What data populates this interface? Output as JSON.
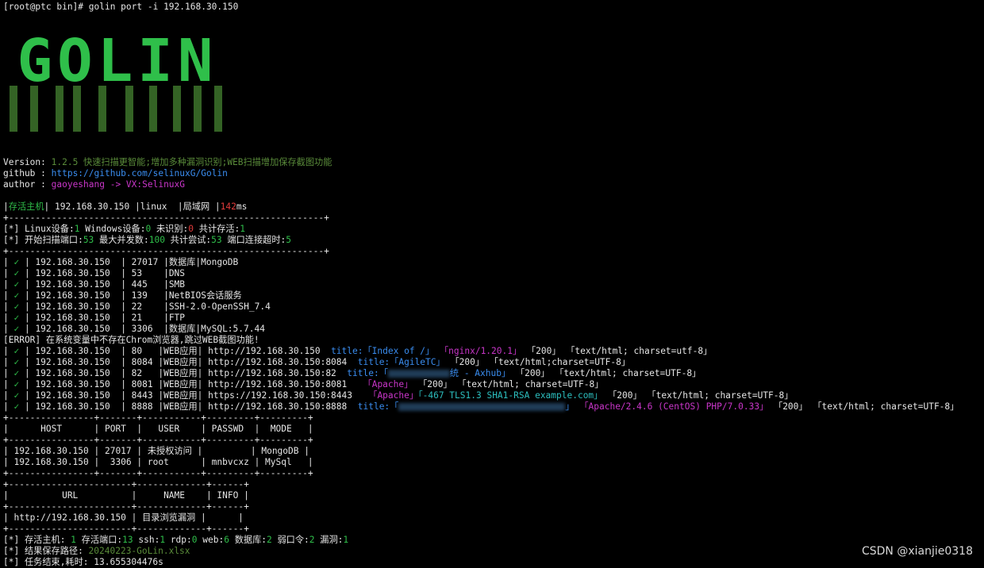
{
  "prompt": "[root@ptc bin]# golin port -i 192.168.30.150",
  "logo_text": "GOLIN",
  "info": {
    "version_label": "Version: ",
    "version_value": "1.2.5 快速扫描更智能;增加多种漏洞识别;WEB扫描增加保存截图功能",
    "github_label": "github : ",
    "github_value": "https://github.com/selinuxG/Golin",
    "author_label": "author : ",
    "author_value": "gaoyeshang -> VX:SelinuxG"
  },
  "host_line": {
    "p1": "|",
    "alive": "存活主机",
    "p2": "| 192.168.30.150 |linux  |局域网 |",
    "ms_value": "142",
    "ms_unit": "ms"
  },
  "separator_a": "+-----------------------------------------------------------+",
  "stats_1": {
    "a": "[*] Linux设备:",
    "linux": "1",
    "b": " Windows设备:",
    "windows": "0",
    "c": " 未识别:",
    "unknown": "0",
    "d": " 共计存活:",
    "total": "1"
  },
  "stats_2": {
    "a": "[*] 开始扫描端口:",
    "ports": "53",
    "b": " 最大并发数:",
    "concurrency": "100",
    "c": " 共计尝试:",
    "attempts": "53",
    "d": " 端口连接超时:",
    "timeout": "5"
  },
  "check_mark": "✓",
  "port_rows": [
    {
      "host": "192.168.30.150",
      "port": "27017",
      "service": "|数据库|MongoDB"
    },
    {
      "host": "192.168.30.150",
      "port": "53   ",
      "service": "|DNS"
    },
    {
      "host": "192.168.30.150",
      "port": "445  ",
      "service": "|SMB"
    },
    {
      "host": "192.168.30.150",
      "port": "139  ",
      "service": "|NetBIOS会话服务"
    },
    {
      "host": "192.168.30.150",
      "port": "22   ",
      "service": "|SSH-2.0-OpenSSH_7.4"
    },
    {
      "host": "192.168.30.150",
      "port": "21   ",
      "service": "|FTP"
    },
    {
      "host": "192.168.30.150",
      "port": "3306 ",
      "service": "|数据库|MySQL:5.7.44"
    }
  ],
  "error_line": "[ERROR] 在系统变量中不存在Chrom浏览器,跳过WEB截图功能!",
  "web_rows": [
    {
      "host": "192.168.30.150",
      "port": "80   ",
      "url": "http://192.168.30.150 ",
      "t_label": " title:",
      "t_value": "「Index of /」",
      "server": "「nginx/1.20.1」",
      "code": "「200」",
      "ctype": "「text/html; charset=utf-8」"
    },
    {
      "host": "192.168.30.150",
      "port": "8084 ",
      "url": "http://192.168.30.150:8084 ",
      "t_label": " title:",
      "t_value": "「AgileTC」",
      "server": "",
      "code": "「200」",
      "ctype": "「text/html;charset=UTF-8」"
    },
    {
      "host": "192.168.30.150",
      "port": "82   ",
      "url": "http://192.168.30.150:82 ",
      "t_label": " title:",
      "t_value": "「",
      "t_value2": "统 - Axhub」",
      "server": "",
      "code": "「200」",
      "ctype": "「text/html; charset=UTF-8」"
    },
    {
      "host": "192.168.30.150",
      "port": "8081 ",
      "url": "http://192.168.30.150:8081 ",
      "t_label": " ",
      "t_value": "",
      "server": "「Apache」",
      "code": "「200」",
      "ctype": "「text/html; charset=UTF-8」"
    },
    {
      "host": "192.168.30.150",
      "port": "8443 ",
      "url": "https://192.168.30.150:8443 ",
      "t_label": " ",
      "t_value": "",
      "server": "「Apache」",
      "tls": "「-467 TLS1.3 SHA1-RSA example.com」",
      "code": "「200」",
      "ctype": "「text/html; charset=UTF-8」"
    },
    {
      "host": "192.168.30.150",
      "port": "8888 ",
      "url": "http://192.168.30.150:8888 ",
      "t_label": " title:",
      "t_value": "「",
      "t_value2": "」",
      "server": "「Apache/2.4.6 (CentOS) PHP/7.0.33」",
      "code": "「200」",
      "ctype": "「text/html; charset=UTF-8」"
    }
  ],
  "weak_table": {
    "border": "+----------------+-------+-----------+---------+---------+",
    "header": "|      HOST      | PORT  |   USER    | PASSWD  |  MODE   |",
    "rows": [
      "| 192.168.30.150 | 27017 | 未授权访问 |         | MongoDB |",
      "| 192.168.30.150 |  3306 | root      | mnbvcxz | MySql   |"
    ]
  },
  "vuln_table": {
    "border": "+-----------------------+-------------+------+",
    "header": "|          URL          |     NAME    | INFO |",
    "rows": [
      "| http://192.168.30.150 | 目录浏览漏洞 |      |"
    ]
  },
  "summary": {
    "a": "[*] 存活主机: ",
    "alive": "1",
    "b": " 存活端口:",
    "ports": "13",
    "c": " ssh:",
    "ssh": "1",
    "d": " rdp:",
    "rdp": "0",
    "e": " web:",
    "web": "6",
    "f": " 数据库:",
    "db": "2",
    "g": " 弱口令:",
    "weak": "2",
    "h": " 漏洞:",
    "vuln": "1"
  },
  "save_label": "[*] 结果保存路径: ",
  "save_path": "20240223-GoLin.xlsx",
  "done_line": "[*] 任务结束,耗时: 13.655304476s",
  "watermark": "CSDN @xianjie0318"
}
